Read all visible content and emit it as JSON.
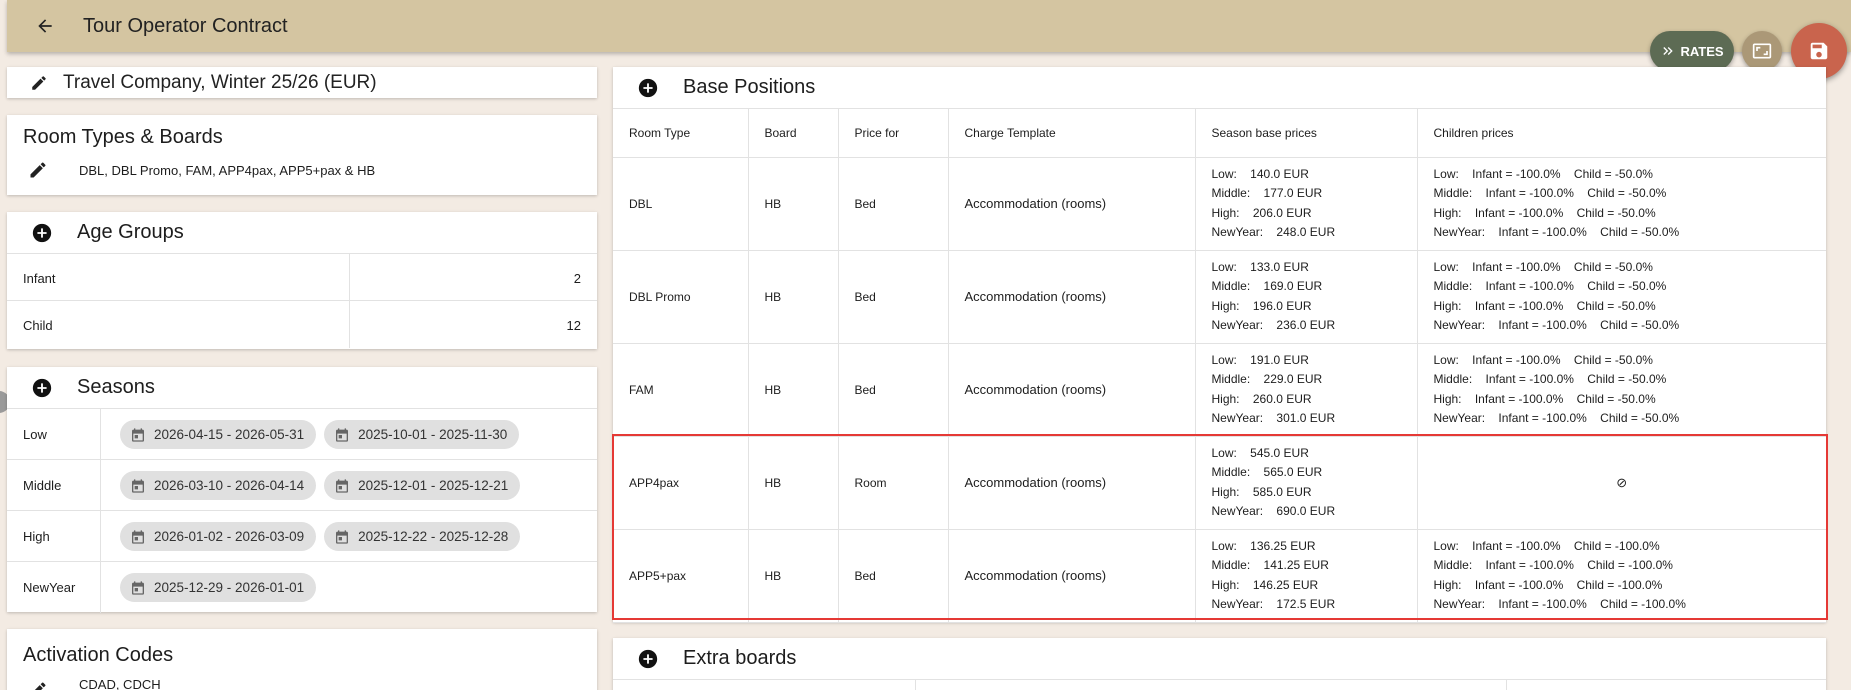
{
  "topbar": {
    "title": "Tour Operator Contract"
  },
  "fabs": {
    "rates_label": "RATES"
  },
  "contract": {
    "title": "Travel Company, Winter 25/26 (EUR)"
  },
  "room_types": {
    "heading": "Room Types & Boards",
    "value": "DBL, DBL Promo, FAM, APP4pax, APP5+pax & HB"
  },
  "age_groups": {
    "heading": "Age Groups",
    "rows": [
      {
        "label": "Infant",
        "value": "2"
      },
      {
        "label": "Child",
        "value": "12"
      }
    ]
  },
  "seasons": {
    "heading": "Seasons",
    "rows": [
      {
        "label": "Low",
        "ranges": [
          "2026-04-15 - 2026-05-31",
          "2025-10-01 - 2025-11-30"
        ]
      },
      {
        "label": "Middle",
        "ranges": [
          "2026-03-10 - 2026-04-14",
          "2025-12-01 - 2025-12-21"
        ]
      },
      {
        "label": "High",
        "ranges": [
          "2026-01-02 - 2026-03-09",
          "2025-12-22 - 2025-12-28"
        ]
      },
      {
        "label": "NewYear",
        "ranges": [
          "2025-12-29 - 2026-01-01"
        ]
      }
    ]
  },
  "activation": {
    "heading": "Activation Codes",
    "value": "CDAD, CDCH"
  },
  "base_positions": {
    "heading": "Base Positions",
    "columns": [
      "Room Type",
      "Board",
      "Price for",
      "Charge Template",
      "Season base prices",
      "Children prices"
    ],
    "rows": [
      {
        "room": "DBL",
        "board": "HB",
        "price_for": "Bed",
        "template": "Accommodation (rooms)",
        "base": [
          "Low:    140.0 EUR",
          "Middle:    177.0 EUR",
          "High:    206.0 EUR",
          "NewYear:    248.0 EUR"
        ],
        "children": [
          "Low:    Infant = -100.0%    Child = -50.0%",
          "Middle:    Infant = -100.0%    Child = -50.0%",
          "High:    Infant = -100.0%    Child = -50.0%",
          "NewYear:    Infant = -100.0%    Child = -50.0%"
        ]
      },
      {
        "room": "DBL Promo",
        "board": "HB",
        "price_for": "Bed",
        "template": "Accommodation (rooms)",
        "base": [
          "Low:    133.0 EUR",
          "Middle:    169.0 EUR",
          "High:    196.0 EUR",
          "NewYear:    236.0 EUR"
        ],
        "children": [
          "Low:    Infant = -100.0%    Child = -50.0%",
          "Middle:    Infant = -100.0%    Child = -50.0%",
          "High:    Infant = -100.0%    Child = -50.0%",
          "NewYear:    Infant = -100.0%    Child = -50.0%"
        ]
      },
      {
        "room": "FAM",
        "board": "HB",
        "price_for": "Bed",
        "template": "Accommodation (rooms)",
        "base": [
          "Low:    191.0 EUR",
          "Middle:    229.0 EUR",
          "High:    260.0 EUR",
          "NewYear:    301.0 EUR"
        ],
        "children": [
          "Low:    Infant = -100.0%    Child = -50.0%",
          "Middle:    Infant = -100.0%    Child = -50.0%",
          "High:    Infant = -100.0%    Child = -50.0%",
          "NewYear:    Infant = -100.0%    Child = -50.0%"
        ]
      },
      {
        "room": "APP4pax",
        "board": "HB",
        "price_for": "Room",
        "template": "Accommodation (rooms)",
        "base": [
          "Low:    545.0 EUR",
          "Middle:    565.0 EUR",
          "High:    585.0 EUR",
          "NewYear:    690.0 EUR"
        ],
        "children": [],
        "children_na": "⊘"
      },
      {
        "room": "APP5+pax",
        "board": "HB",
        "price_for": "Bed",
        "template": "Accommodation (rooms)",
        "base": [
          "Low:    136.25 EUR",
          "Middle:    141.25 EUR",
          "High:    146.25 EUR",
          "NewYear:    172.5 EUR"
        ],
        "children": [
          "Low:    Infant = -100.0%    Child = -100.0%",
          "Middle:    Infant = -100.0%    Child = -100.0%",
          "High:    Infant = -100.0%    Child = -100.0%",
          "NewYear:    Infant = -100.0%    Child = -100.0%"
        ]
      }
    ]
  },
  "extra_boards": {
    "heading": "Extra boards"
  },
  "colors": {
    "topbar": "#d4c5a1",
    "background": "#f3ebe3",
    "rates_fab": "#5d6b54",
    "expand_fab": "#ab9877",
    "save_fab": "#c9644d",
    "highlight": "#e53935"
  }
}
